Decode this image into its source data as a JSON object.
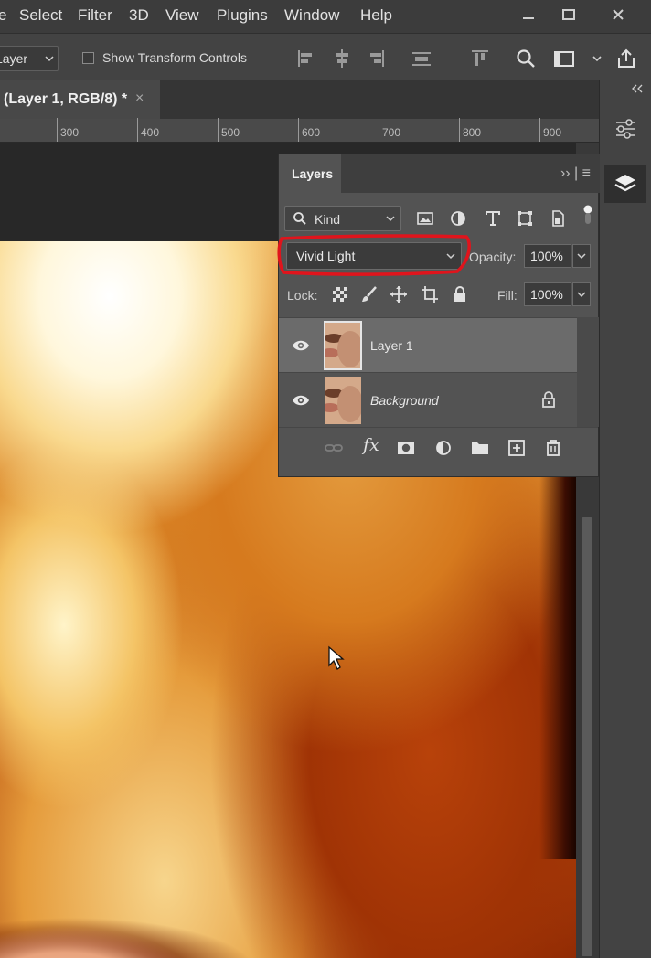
{
  "menubar": {
    "items": [
      "e",
      "Select",
      "Filter",
      "3D",
      "View",
      "Plugins",
      "Window",
      "Help"
    ],
    "window_controls": [
      "minimize-icon",
      "maximize-icon",
      "close-icon"
    ]
  },
  "options": {
    "layer_dropdown": "Layer",
    "show_transform_controls": "Show Transform Controls",
    "show_transform_checked": false
  },
  "document": {
    "tab_label": "(Layer 1, RGB/8) *",
    "close": "×"
  },
  "ruler": {
    "labels": [
      "300",
      "400",
      "500",
      "600",
      "700",
      "800",
      "900"
    ]
  },
  "layers_panel": {
    "tab_title": "Layers",
    "header_icons": "›› | ≡",
    "filter_kind": "Kind",
    "blend_mode": "Vivid Light",
    "opacity_label": "Opacity:",
    "opacity_value": "100%",
    "lock_label": "Lock:",
    "fill_label": "Fill:",
    "fill_value": "100%",
    "layers": [
      {
        "name": "Layer 1",
        "visible": true,
        "selected": true,
        "locked": false
      },
      {
        "name": "Background",
        "visible": true,
        "selected": false,
        "locked": true
      }
    ],
    "footer_icons": [
      "link-icon",
      "fx-icon",
      "mask-icon",
      "adjustment-icon",
      "folder-icon",
      "new-layer-icon",
      "trash-icon"
    ],
    "fx_label": "fx"
  },
  "highlight_color": "#e0141c"
}
